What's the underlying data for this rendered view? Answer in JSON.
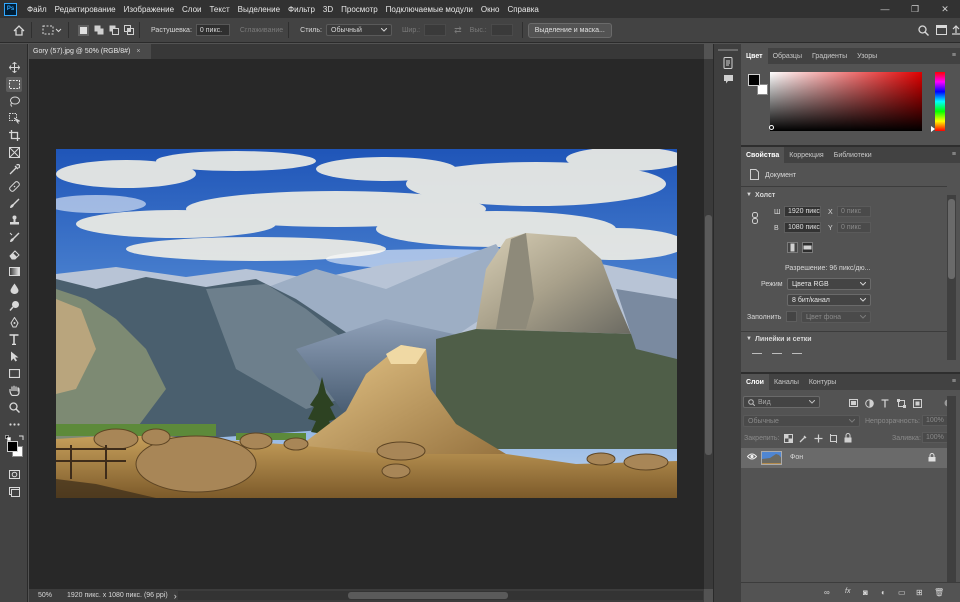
{
  "app": {
    "logo": "Ps",
    "menu": [
      "Файл",
      "Редактирование",
      "Изображение",
      "Слои",
      "Текст",
      "Выделение",
      "Фильтр",
      "3D",
      "Просмотр",
      "Подключаемые модули",
      "Окно",
      "Справка"
    ],
    "window_controls": [
      "—",
      "❐",
      "✕"
    ]
  },
  "options": {
    "feather_label": "Растушевка:",
    "feather_value": "0 пикс.",
    "antialias_label": "Сглаживание",
    "style_label": "Стиль:",
    "style_value": "Обычный",
    "width_label": "Шир.:",
    "height_label": "Выс.:",
    "swap_icon": "⇄",
    "select_mask_button": "Выделение и маска..."
  },
  "document": {
    "tab_title": "Gory (57).jpg @ 50% (RGB/8#)",
    "tab_close": "×",
    "zoom": "50%",
    "info": "1920 пикс. x 1080 пикс. (96 ppi)",
    "info_arrow": "›"
  },
  "color_panel": {
    "tabs": [
      "Цвет",
      "Образцы",
      "Градиенты",
      "Узоры"
    ],
    "hue_base": "#e00000"
  },
  "properties_panel": {
    "tabs": [
      "Свойства",
      "Коррекция",
      "Библиотеки"
    ],
    "doc_label": "Документ",
    "canvas_header": "Холст",
    "w_label": "Ш",
    "w_value": "1920 пикс",
    "h_label": "В",
    "h_value": "1080 пикс",
    "x_label": "X",
    "x_placeholder": "0 пикс",
    "y_label": "Y",
    "y_placeholder": "0 пикс",
    "resolution": "Разрешение: 96 пикс/дю...",
    "mode_label": "Режим",
    "mode_value": "Цвета RGB",
    "depth_value": "8 бит/канал",
    "fill_label": "Заполнить",
    "fill_value": "Цвет фона",
    "rulers_header": "Линейки и сетки"
  },
  "layers_panel": {
    "tabs": [
      "Слои",
      "Каналы",
      "Контуры"
    ],
    "search_placeholder": "Вид",
    "blend_mode": "Обычные",
    "opacity_label": "Непрозрачность:",
    "opacity_value": "100%",
    "lock_label": "Закрепить:",
    "fill_label": "Заливка:",
    "fill_value": "100%",
    "layers": [
      {
        "name": "Фон",
        "visible_icon": "👁",
        "lock_icon": "🔒"
      }
    ],
    "footer_icons": [
      "∞",
      "fx",
      "◙",
      "◐",
      "▭",
      "⊞",
      "🗑"
    ]
  }
}
